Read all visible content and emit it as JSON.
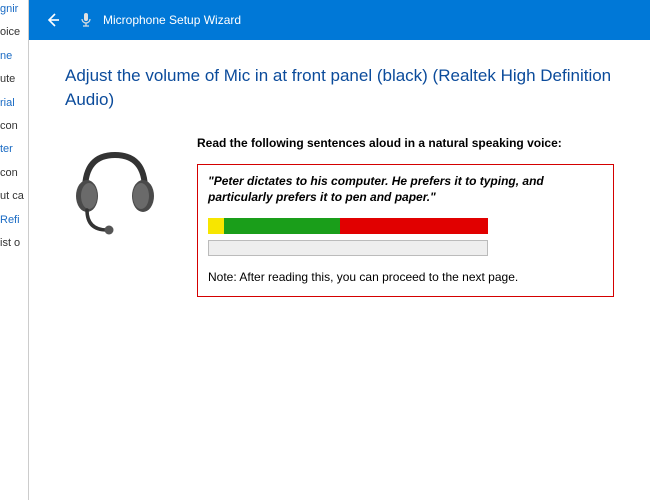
{
  "bg": {
    "f1": "gnir",
    "f2": "oice",
    "f3": "ne",
    "f4": "ute",
    "f5": "rial",
    "f6": "con",
    "f7": "ter",
    "f8": "con",
    "f9": "ut ca",
    "f10": "Refi",
    "f11": "ist o"
  },
  "titlebar": {
    "title": "Microphone Setup Wizard"
  },
  "heading": "Adjust the volume of Mic in at front panel (black) (Realtek High Definition Audio)",
  "instruction": "Read the following sentences aloud in a natural speaking voice:",
  "sample": "\"Peter dictates to his computer. He prefers it to typing, and particularly prefers it to pen and paper.\"",
  "note": "Note: After reading this, you can proceed to the next page."
}
